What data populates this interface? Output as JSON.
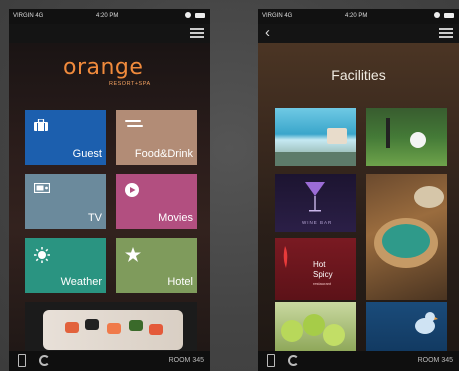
{
  "status_bar": {
    "carrier": "VIRGIN 4G",
    "time": "4:20 PM"
  },
  "home": {
    "logo": {
      "word": "orange",
      "tagline": "RESORT+SPA"
    },
    "tiles": [
      {
        "label": "Guest",
        "icon": "briefcase-icon",
        "color": "#1c5fae"
      },
      {
        "label": "Food&Drink",
        "icon": "fork-knife-icon",
        "color": "#b28c76"
      },
      {
        "label": "TV",
        "icon": "tv-icon",
        "color": "#6b8a9c"
      },
      {
        "label": "Movies",
        "icon": "play-icon",
        "color": "#b24f80"
      },
      {
        "label": "Weather",
        "icon": "sun-icon",
        "color": "#2a9481"
      },
      {
        "label": "Hotel",
        "icon": "star-icon",
        "color": "#7f9b5c"
      }
    ],
    "room": "ROOM 345"
  },
  "facilities": {
    "title": "Facilities",
    "tiles": [
      {
        "name": "pool"
      },
      {
        "name": "golf"
      },
      {
        "name": "wine-bar",
        "label": "WINE BAR"
      },
      {
        "name": "spa"
      },
      {
        "name": "hot-spicy",
        "label_1": "Hot",
        "label_2": "Spicy",
        "label_3": "restaurant"
      },
      {
        "name": "fruit"
      },
      {
        "name": "bird"
      }
    ],
    "room": "ROOM 345"
  },
  "colors": {
    "accent": "#f08a3c"
  }
}
